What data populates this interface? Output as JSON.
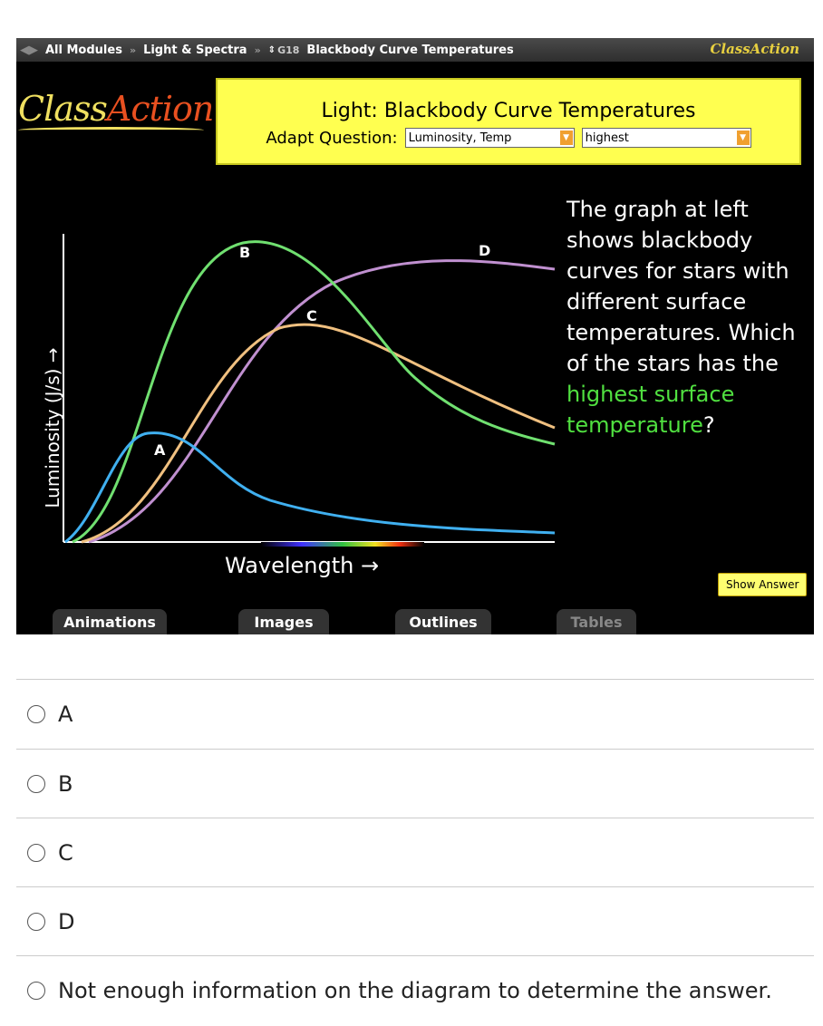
{
  "toolbar": {
    "crumbs": [
      "All Modules",
      "Light & Spectra",
      "G18",
      "Blackbody Curve Temperatures"
    ],
    "logo": "ClassAction"
  },
  "logo": {
    "text1": "Class",
    "text2": "Action"
  },
  "header": {
    "title": "Light: Blackbody Curve Temperatures",
    "adapt_label": "Adapt Question:",
    "select1": "Luminosity, Temp",
    "select2": "highest"
  },
  "graph": {
    "ylabel": "Luminosity (J/s) →",
    "xlabel": "Wavelength →",
    "curves": [
      "A",
      "B",
      "C",
      "D"
    ],
    "colors": {
      "A": "#40b0f0",
      "B": "#70e070",
      "C": "#f0c080",
      "D": "#c090d0"
    }
  },
  "question": {
    "part1": "The graph at left shows blackbody curves for stars with different surface temperatures. Which of the stars has the ",
    "hl": "highest surface temperature",
    "part2": "?"
  },
  "show_answer": "Show Answer",
  "tabs": [
    "Animations",
    "Images",
    "Outlines",
    "Tables"
  ],
  "options": [
    "A",
    "B",
    "C",
    "D",
    "Not enough information on the diagram to determine the answer."
  ]
}
